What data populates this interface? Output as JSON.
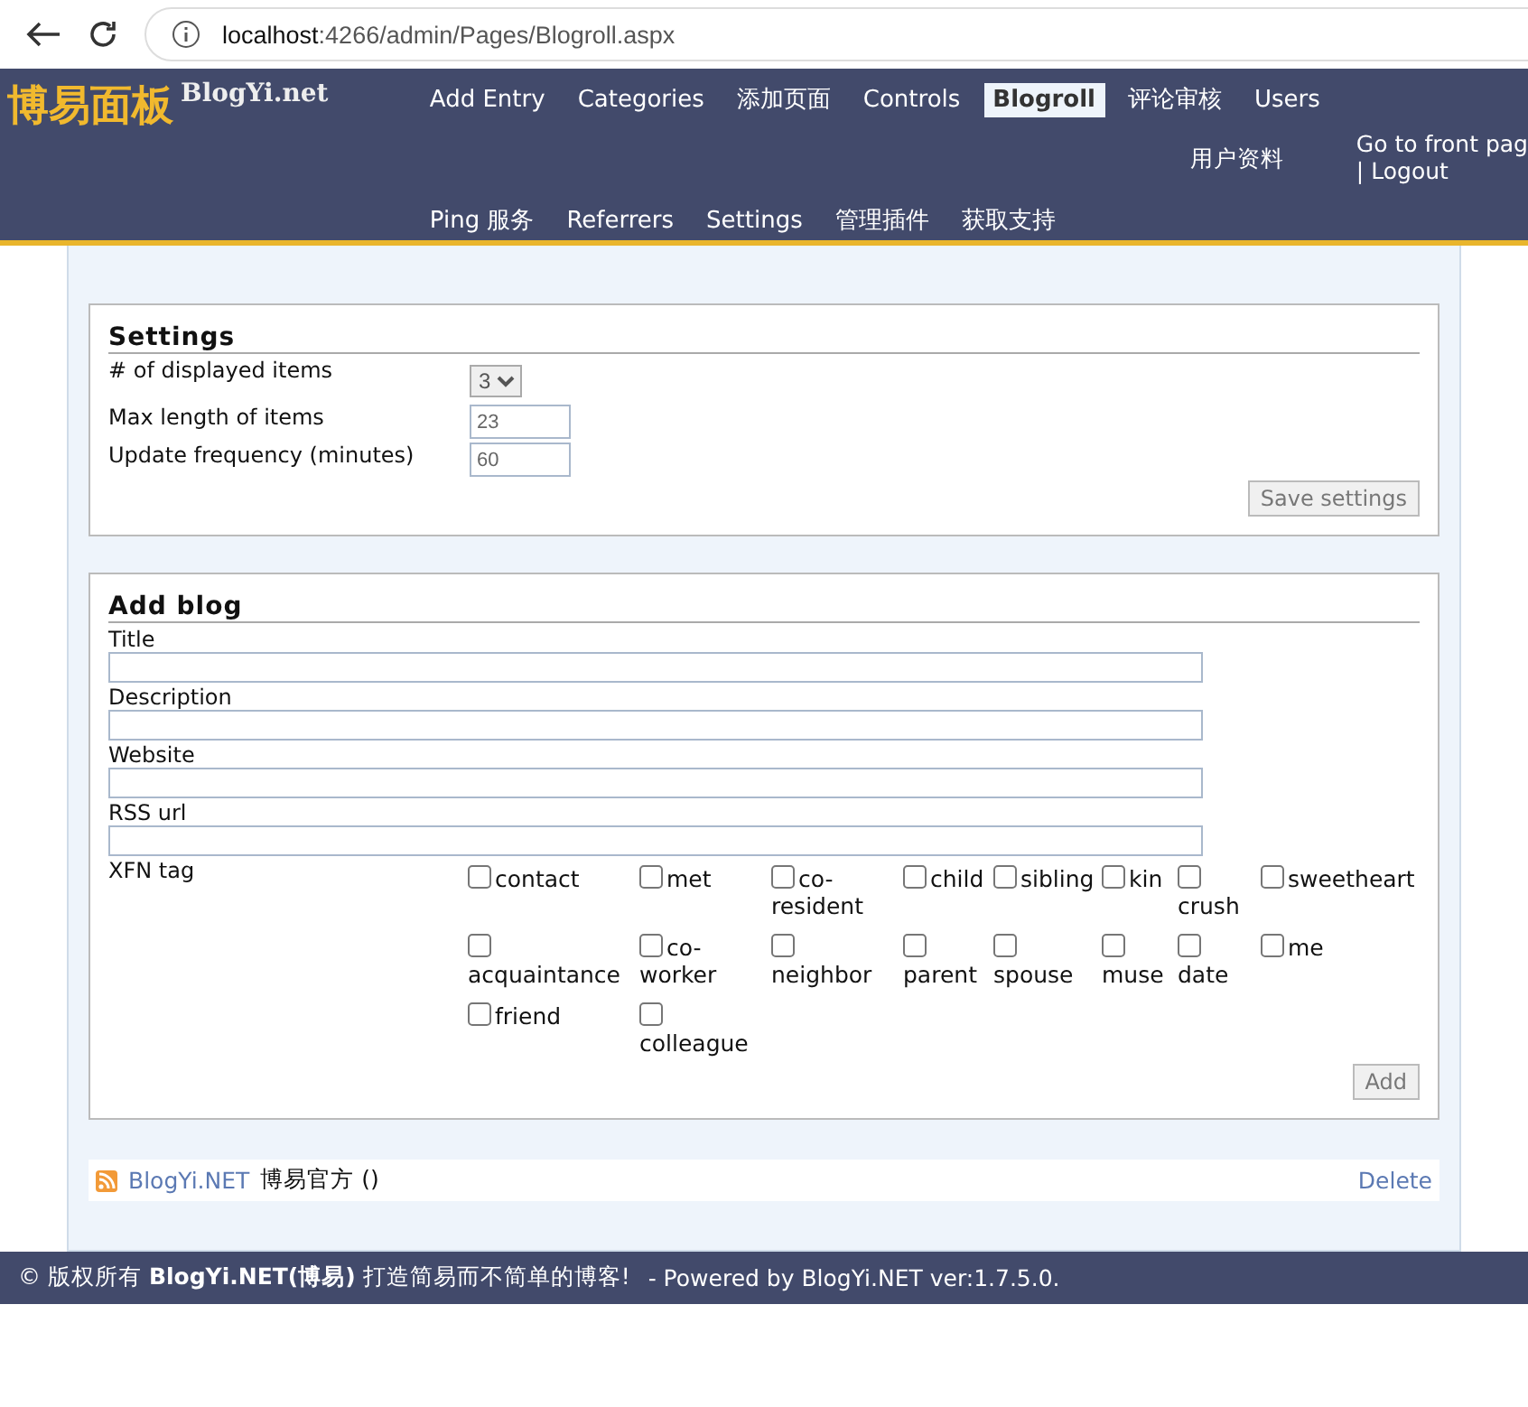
{
  "browser": {
    "url_host": "localhost",
    "url_rest": ":4266/admin/Pages/Blogroll.aspx"
  },
  "header": {
    "logo": "博易面板",
    "brand": "BlogYi.net",
    "nav_row_1": [
      {
        "label": "Add Entry",
        "selected": false
      },
      {
        "label": "Categories",
        "selected": false
      },
      {
        "label": "添加页面",
        "selected": false
      },
      {
        "label": "Controls",
        "selected": false
      },
      {
        "label": "Blogroll",
        "selected": true
      },
      {
        "label": "评论审核",
        "selected": false
      },
      {
        "label": "Users",
        "selected": false
      }
    ],
    "profile_link": "用户资料",
    "front_page_link": "Go to front pag",
    "separator": "|",
    "logout_link": "Logout",
    "nav_row_2": [
      {
        "label": "Ping 服务",
        "selected": false
      },
      {
        "label": "Referrers",
        "selected": false
      },
      {
        "label": "Settings",
        "selected": false
      },
      {
        "label": "管理插件",
        "selected": false
      },
      {
        "label": "获取支持",
        "selected": false
      }
    ]
  },
  "settings": {
    "title": "Settings",
    "displayed_items": {
      "label": "# of displayed items",
      "value": "3"
    },
    "max_length": {
      "label": "Max length of items",
      "value": "23"
    },
    "update_frequency": {
      "label": "Update frequency (minutes)",
      "value": "60"
    },
    "save_button": "Save settings"
  },
  "add_blog": {
    "title": "Add blog",
    "fields": [
      {
        "label": "Title"
      },
      {
        "label": "Description"
      },
      {
        "label": "Website"
      },
      {
        "label": "RSS url"
      }
    ],
    "xfn_label": "XFN tag",
    "xfn": [
      {
        "label": "contact",
        "checked": false
      },
      {
        "label": "met",
        "checked": false
      },
      {
        "label": "co-resident",
        "checked": false
      },
      {
        "label": "child",
        "checked": false
      },
      {
        "label": "sibling",
        "checked": false
      },
      {
        "label": "kin",
        "checked": false
      },
      {
        "label": "crush",
        "checked": false
      },
      {
        "label": "sweetheart",
        "checked": false
      },
      {
        "label": "acquaintance",
        "checked": false
      },
      {
        "label": "co-worker",
        "checked": false
      },
      {
        "label": "neighbor",
        "checked": false
      },
      {
        "label": "parent",
        "checked": false
      },
      {
        "label": "spouse",
        "checked": false
      },
      {
        "label": "muse",
        "checked": false
      },
      {
        "label": "date",
        "checked": false
      },
      {
        "label": "me",
        "checked": false
      },
      {
        "label": "friend",
        "checked": false
      },
      {
        "label": "colleague",
        "checked": false
      }
    ],
    "add_button": "Add"
  },
  "blogroll": [
    {
      "name": "BlogYi.NET",
      "description": "博易官方 ()",
      "delete": "Delete"
    }
  ],
  "footer": {
    "copyright": "© 版权所有 **BlogYi.NET(博易)** 打造简易而不简单的博客!",
    "powered": "- Powered by BlogYi.NET ver:1.7.5.0."
  }
}
